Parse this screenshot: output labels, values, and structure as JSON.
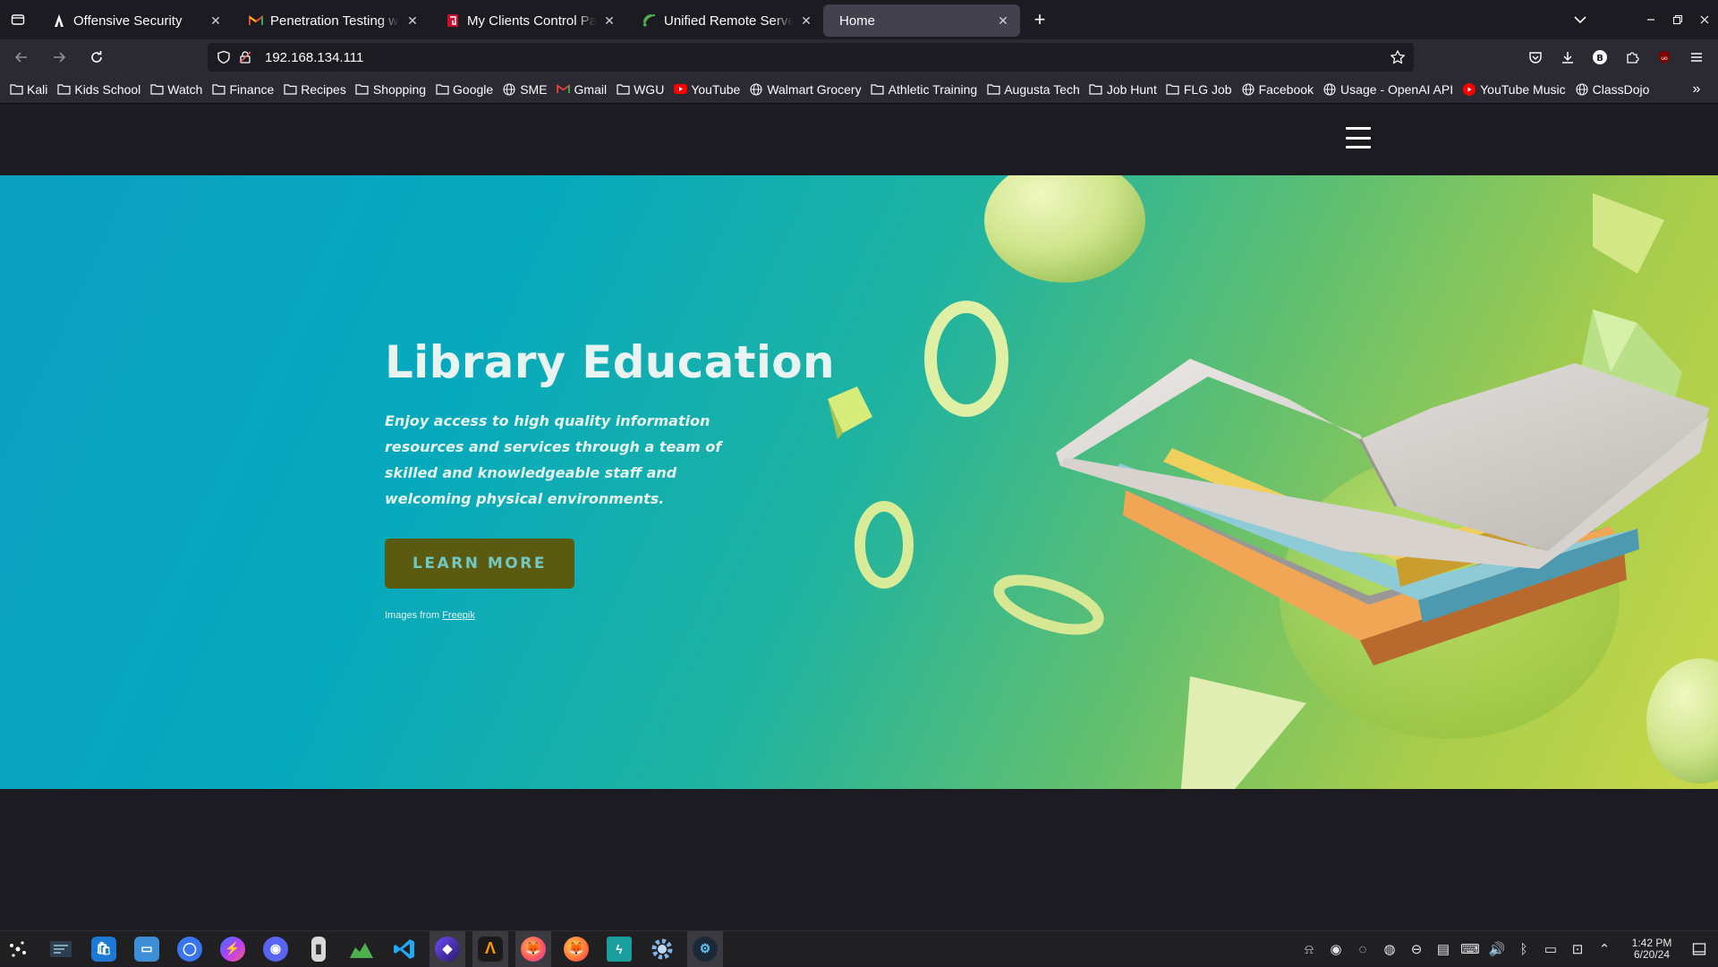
{
  "browser": {
    "tabs": [
      {
        "title": "Offensive Security",
        "favicon": "offsec-icon",
        "active": false
      },
      {
        "title": "Penetration Testing with K",
        "favicon": "gmail-icon",
        "active": false
      },
      {
        "title": "My Clients Control Panel |",
        "favicon": "clients-panel-icon",
        "active": false
      },
      {
        "title": "Unified Remote Server",
        "favicon": "unified-remote-icon",
        "active": false
      },
      {
        "title": "Home",
        "favicon": "",
        "active": true
      }
    ],
    "new_tab": "+",
    "url": "192.168.134.111",
    "bookmarks": [
      {
        "label": "Kali",
        "icon": "folder-icon"
      },
      {
        "label": "Kids School",
        "icon": "folder-icon"
      },
      {
        "label": "Watch",
        "icon": "folder-icon"
      },
      {
        "label": "Finance",
        "icon": "folder-icon"
      },
      {
        "label": "Recipes",
        "icon": "folder-icon"
      },
      {
        "label": "Shopping",
        "icon": "folder-icon"
      },
      {
        "label": "Google",
        "icon": "folder-icon"
      },
      {
        "label": "SME",
        "icon": "globe-icon"
      },
      {
        "label": "Gmail",
        "icon": "gmail-icon"
      },
      {
        "label": "WGU",
        "icon": "folder-icon"
      },
      {
        "label": "YouTube",
        "icon": "youtube-icon"
      },
      {
        "label": "Walmart Grocery",
        "icon": "globe-icon"
      },
      {
        "label": "Athletic Training",
        "icon": "folder-icon"
      },
      {
        "label": "Augusta Tech",
        "icon": "folder-icon"
      },
      {
        "label": "Job Hunt",
        "icon": "folder-icon"
      },
      {
        "label": "FLG Job",
        "icon": "folder-icon"
      },
      {
        "label": "Facebook",
        "icon": "globe-icon"
      },
      {
        "label": "Usage - OpenAI API",
        "icon": "globe-icon"
      },
      {
        "label": "YouTube Music",
        "icon": "youtube-music-icon"
      },
      {
        "label": "ClassDojo",
        "icon": "globe-icon"
      }
    ],
    "colors": {
      "toolbar": "#2b2a33",
      "tabstrip": "#1c1b22",
      "active_tab": "#42414d"
    }
  },
  "page": {
    "hero": {
      "title": "Library Education",
      "text": "Enjoy access to high quality information resources and services through a team of skilled and knowledgeable staff and welcoming physical environments.",
      "button": "LEARN MORE",
      "credit_prefix": "Images from ",
      "credit_link": "Freepik",
      "colors": {
        "gradient_start": "#0b9fc2",
        "gradient_end": "#c9d84b",
        "button_bg": "#5a5a10",
        "button_text": "#73c9c0"
      }
    }
  },
  "taskbar": {
    "apps": [
      "kde-menu-icon",
      "system-settings-icon",
      "discover-store-icon",
      "file-manager-icon",
      "signal-icon",
      "messenger-icon",
      "discord-icon",
      "usb-drive-icon",
      "system-monitor-icon",
      "vscode-icon",
      "proton-pass-icon",
      "sublime-icon",
      "firefox-icon",
      "firefox-alt-icon",
      "bolt-icon",
      "settings-gear-icon",
      "steam-icon"
    ],
    "clock_time": "1:42 PM",
    "clock_date": "6/20/24"
  }
}
